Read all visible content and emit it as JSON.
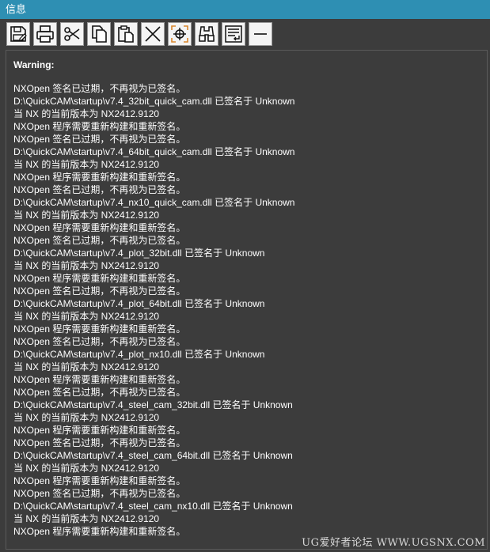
{
  "window": {
    "title": "信息"
  },
  "toolbar": {
    "buttons": [
      {
        "name": "save-icon"
      },
      {
        "name": "print-icon"
      },
      {
        "name": "cut-icon"
      },
      {
        "name": "copy-icon"
      },
      {
        "name": "paste-icon"
      },
      {
        "name": "clear-icon"
      },
      {
        "name": "target-icon"
      },
      {
        "name": "binoculars-icon"
      },
      {
        "name": "wrap-text-icon"
      },
      {
        "name": "minimize-icon"
      }
    ]
  },
  "panel": {
    "warning_title": "Warning:",
    "lines": [
      "NXOpen 签名已过期，不再视为已签名。",
      "D:\\QuickCAM\\startup\\v7.4_32bit_quick_cam.dll 已签名于 Unknown",
      "当 NX 的当前版本为 NX2412.9120",
      "NXOpen 程序需要重新构建和重新签名。",
      "NXOpen 签名已过期，不再视为已签名。",
      "D:\\QuickCAM\\startup\\v7.4_64bit_quick_cam.dll 已签名于 Unknown",
      "当 NX 的当前版本为 NX2412.9120",
      "NXOpen 程序需要重新构建和重新签名。",
      "NXOpen 签名已过期，不再视为已签名。",
      "D:\\QuickCAM\\startup\\v7.4_nx10_quick_cam.dll 已签名于 Unknown",
      "当 NX 的当前版本为 NX2412.9120",
      "NXOpen 程序需要重新构建和重新签名。",
      "NXOpen 签名已过期，不再视为已签名。",
      "D:\\QuickCAM\\startup\\v7.4_plot_32bit.dll 已签名于 Unknown",
      "当 NX 的当前版本为 NX2412.9120",
      "NXOpen 程序需要重新构建和重新签名。",
      "NXOpen 签名已过期，不再视为已签名。",
      "D:\\QuickCAM\\startup\\v7.4_plot_64bit.dll 已签名于 Unknown",
      "当 NX 的当前版本为 NX2412.9120",
      "NXOpen 程序需要重新构建和重新签名。",
      "NXOpen 签名已过期，不再视为已签名。",
      "D:\\QuickCAM\\startup\\v7.4_plot_nx10.dll 已签名于 Unknown",
      "当 NX 的当前版本为 NX2412.9120",
      "NXOpen 程序需要重新构建和重新签名。",
      "NXOpen 签名已过期，不再视为已签名。",
      "D:\\QuickCAM\\startup\\v7.4_steel_cam_32bit.dll 已签名于 Unknown",
      "当 NX 的当前版本为 NX2412.9120",
      "NXOpen 程序需要重新构建和重新签名。",
      "NXOpen 签名已过期，不再视为已签名。",
      "D:\\QuickCAM\\startup\\v7.4_steel_cam_64bit.dll 已签名于 Unknown",
      "当 NX 的当前版本为 NX2412.9120",
      "NXOpen 程序需要重新构建和重新签名。",
      "NXOpen 签名已过期，不再视为已签名。",
      "D:\\QuickCAM\\startup\\v7.4_steel_cam_nx10.dll 已签名于 Unknown",
      "当 NX 的当前版本为 NX2412.9120",
      "NXOpen 程序需要重新构建和重新签名。"
    ]
  },
  "watermark": "UG爱好者论坛 WWW.UGSNX.COM",
  "colors": {
    "titlebar": "#2e8fb3",
    "background": "#3c3c3c",
    "text": "#ffffff",
    "button_face": "#f4f4f4"
  }
}
